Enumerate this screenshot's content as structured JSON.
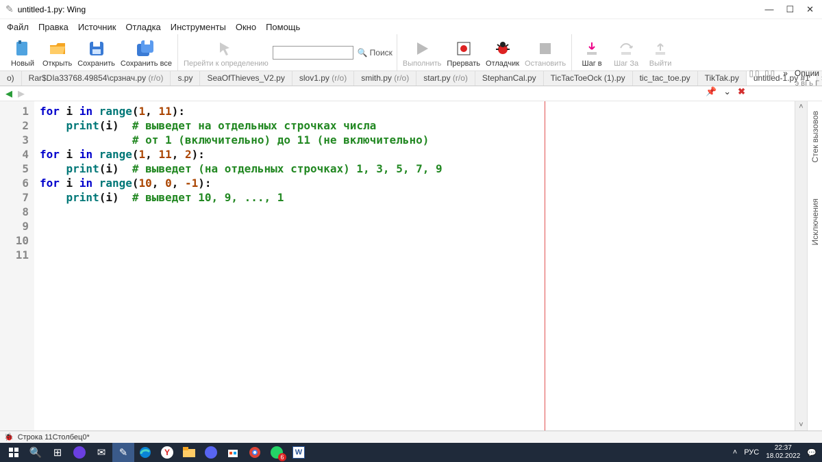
{
  "window": {
    "title": "untitled-1.py: Wing"
  },
  "menu": [
    "Файл",
    "Правка",
    "Источник",
    "Отладка",
    "Инструменты",
    "Окно",
    "Помощь"
  ],
  "toolbar": {
    "new": "Новый",
    "open": "Открыть",
    "save": "Сохранить",
    "saveall": "Сохранить все",
    "goto": "Перейти к определению",
    "search": "Поиск",
    "run": "Выполнить",
    "stop": "Прервать",
    "debug": "Отладчик",
    "halt": "Остановить",
    "stepin": "Шаг в",
    "stepover": "Шаг За",
    "stepout": "Выйти"
  },
  "tabs": [
    {
      "label": "o)",
      "ro": false
    },
    {
      "label": "Rar$DIa33768.49854\\срзнач.py",
      "ro": true
    },
    {
      "label": "s.py",
      "ro": false
    },
    {
      "label": "SeaOfThieves_V2.py",
      "ro": false
    },
    {
      "label": "slov1.py",
      "ro": true
    },
    {
      "label": "smith.py",
      "ro": true
    },
    {
      "label": "start.py",
      "ro": true
    },
    {
      "label": "StephanCal.py",
      "ro": false
    },
    {
      "label": "TicTacToeOck (1).py",
      "ro": false
    },
    {
      "label": "tic_tac_toe.py",
      "ro": false
    },
    {
      "label": "TikTak.py",
      "ro": false
    },
    {
      "label": "untitled-1.py #1",
      "ro": false,
      "active": true
    }
  ],
  "options_label": "Опции",
  "tab_icons_hint": "э вІ ь Г",
  "side_tabs": [
    "Стек вызовов",
    "Исключения"
  ],
  "code_lines": 11,
  "code": [
    [
      [
        "kw",
        "for"
      ],
      [
        "nm",
        " i "
      ],
      [
        "kw",
        "in"
      ],
      [
        "nm",
        " "
      ],
      [
        "fn",
        "range"
      ],
      [
        "nm",
        "("
      ],
      [
        "num",
        "1"
      ],
      [
        "nm",
        ", "
      ],
      [
        "num",
        "11"
      ],
      [
        "nm",
        "):"
      ]
    ],
    [
      [
        "nm",
        "    "
      ],
      [
        "fn",
        "print"
      ],
      [
        "nm",
        "(i)  "
      ],
      [
        "cm",
        "# выведет на отдельных строчках числа"
      ]
    ],
    [
      [
        "nm",
        "              "
      ],
      [
        "cm",
        "# от 1 (включительно) до 11 (не включительно)"
      ]
    ],
    [
      [
        "kw",
        "for"
      ],
      [
        "nm",
        " i "
      ],
      [
        "kw",
        "in"
      ],
      [
        "nm",
        " "
      ],
      [
        "fn",
        "range"
      ],
      [
        "nm",
        "("
      ],
      [
        "num",
        "1"
      ],
      [
        "nm",
        ", "
      ],
      [
        "num",
        "11"
      ],
      [
        "nm",
        ", "
      ],
      [
        "num",
        "2"
      ],
      [
        "nm",
        "):"
      ]
    ],
    [
      [
        "nm",
        "    "
      ],
      [
        "fn",
        "print"
      ],
      [
        "nm",
        "(i)  "
      ],
      [
        "cm",
        "# выведет (на отдельных строчках) 1, 3, 5, 7, 9"
      ]
    ],
    [
      [
        "kw",
        "for"
      ],
      [
        "nm",
        " i "
      ],
      [
        "kw",
        "in"
      ],
      [
        "nm",
        " "
      ],
      [
        "fn",
        "range"
      ],
      [
        "nm",
        "("
      ],
      [
        "num",
        "10"
      ],
      [
        "nm",
        ", "
      ],
      [
        "num",
        "0"
      ],
      [
        "nm",
        ", "
      ],
      [
        "num",
        "-1"
      ],
      [
        "nm",
        "):"
      ]
    ],
    [
      [
        "nm",
        "    "
      ],
      [
        "fn",
        "print"
      ],
      [
        "nm",
        "(i)  "
      ],
      [
        "cm",
        "# выведет 10, 9, ..., 1"
      ]
    ],
    [],
    [],
    [],
    []
  ],
  "status": {
    "line": "Строка 11",
    "col": "Столбец0",
    "mod": " *",
    "bug": "⚙"
  },
  "tray": {
    "lang": "РУС",
    "time": "22:37",
    "date": "18.02.2022"
  }
}
